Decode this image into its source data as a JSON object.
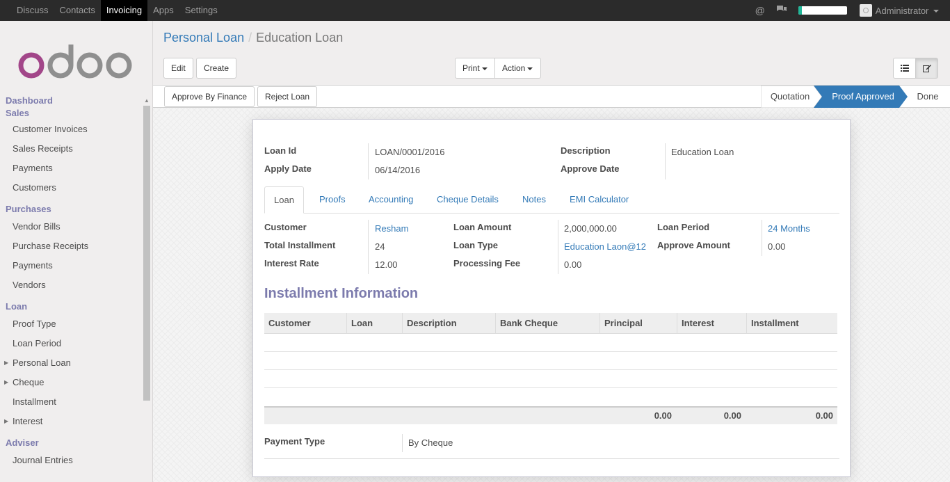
{
  "topbar": {
    "menu": [
      "Discuss",
      "Contacts",
      "Invoicing",
      "Apps",
      "Settings"
    ],
    "active": "Invoicing",
    "icons": [
      "at-icon",
      "chat-icon"
    ],
    "progress_fraction": 0.08,
    "user": "Administrator",
    "accent": "#21b799"
  },
  "sidebar": {
    "logo": "odoo",
    "sections": [
      {
        "title": "Dashboard",
        "items": []
      },
      {
        "title": "Sales",
        "items": [
          "Customer Invoices",
          "Sales Receipts",
          "Payments",
          "Customers"
        ]
      },
      {
        "title": "Purchases",
        "items": [
          "Vendor Bills",
          "Purchase Receipts",
          "Payments",
          "Vendors"
        ]
      },
      {
        "title": "Loan",
        "items": [
          "Proof Type",
          "Loan Period",
          "Personal Loan",
          "Cheque",
          "Installment",
          "Interest"
        ]
      },
      {
        "title": "Adviser",
        "items": [
          "Journal Entries"
        ]
      }
    ],
    "expandable": [
      "Personal Loan",
      "Cheque",
      "Interest"
    ]
  },
  "breadcrumb": {
    "parent": "Personal Loan",
    "current": "Education Loan"
  },
  "buttons": {
    "edit": "Edit",
    "create": "Create",
    "print": "Print",
    "action": "Action"
  },
  "statusbar": {
    "approve": "Approve By Finance",
    "reject": "Reject Loan",
    "stages": [
      "Quotation",
      "Proof Approved",
      "Done"
    ],
    "active_stage": "Proof Approved",
    "active_color": "#337ab7"
  },
  "form": {
    "loan_id_label": "Loan Id",
    "loan_id": "LOAN/0001/2016",
    "apply_date_label": "Apply Date",
    "apply_date": "06/14/2016",
    "description_label": "Description",
    "description": "Education Loan",
    "approve_date_label": "Approve Date",
    "approve_date": ""
  },
  "tabs": [
    "Loan",
    "Proofs",
    "Accounting",
    "Cheque Details",
    "Notes",
    "EMI Calculator"
  ],
  "loan": {
    "customer_label": "Customer",
    "customer": "Resham",
    "total_installment_label": "Total Installment",
    "total_installment": "24",
    "interest_rate_label": "Interest Rate",
    "interest_rate": "12.00",
    "loan_amount_label": "Loan Amount",
    "loan_amount": "2,000,000.00",
    "loan_type_label": "Loan Type",
    "loan_type": "Education Laon@12",
    "processing_fee_label": "Processing Fee",
    "processing_fee": "0.00",
    "loan_period_label": "Loan Period",
    "loan_period": "24 Months",
    "approve_amount_label": "Approve Amount",
    "approve_amount": "0.00"
  },
  "installment": {
    "title": "Installment Information",
    "columns": [
      "Customer",
      "Loan",
      "Description",
      "Bank Cheque",
      "Principal",
      "Interest",
      "Installment"
    ],
    "rows": [],
    "totals": {
      "principal": "0.00",
      "interest": "0.00",
      "installment": "0.00"
    }
  },
  "payment": {
    "label": "Payment Type",
    "value": "By Cheque"
  }
}
